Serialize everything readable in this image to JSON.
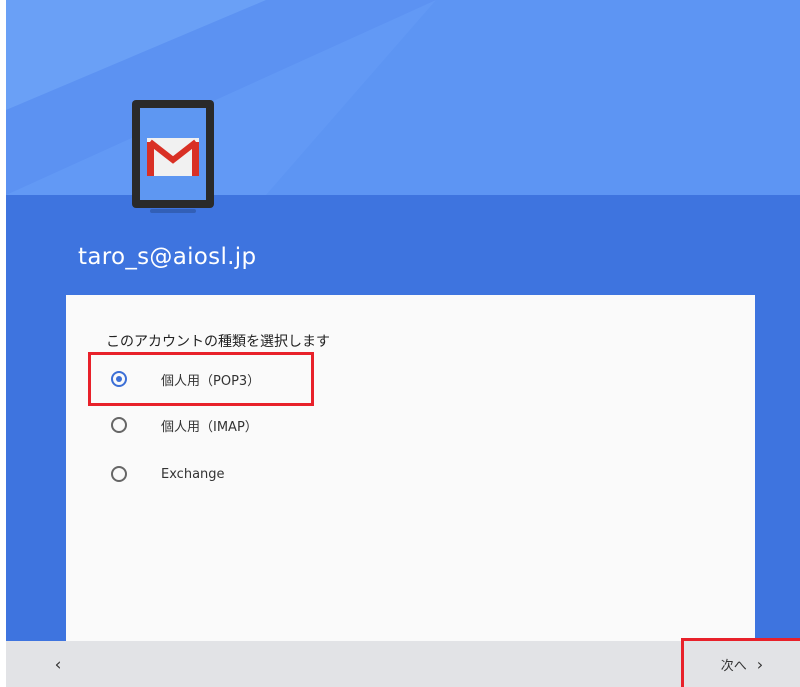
{
  "account": {
    "email": "taro_s@aiosl.jp"
  },
  "account_type": {
    "title": "このアカウントの種類を選択します",
    "selected_index": 0,
    "options": [
      {
        "label": "個人用（POP3）",
        "checked": true
      },
      {
        "label": "個人用（IMAP）",
        "checked": false
      },
      {
        "label": "Exchange",
        "checked": false
      }
    ]
  },
  "nav": {
    "back_label": "‹",
    "next_label": "次へ",
    "next_chevron": "›"
  },
  "colors": {
    "header_light": "#6299f5",
    "header_dark": "#3e74df",
    "radio_accent": "#3c6fd6",
    "highlight": "#e8212a",
    "gmail_red": "#d93025"
  },
  "icons": [
    "gmail-icon",
    "phone-icon",
    "radio-checked-icon",
    "radio-unchecked-icon",
    "chevron-left-icon",
    "chevron-right-icon"
  ]
}
